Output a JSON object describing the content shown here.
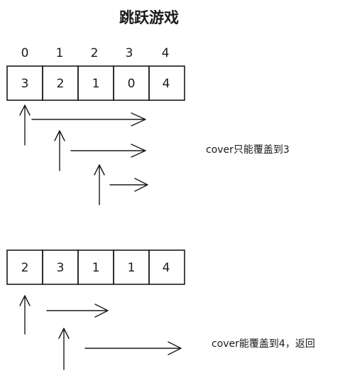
{
  "title": "跳跃游戏",
  "example1": {
    "indices": [
      "0",
      "1",
      "2",
      "3",
      "4"
    ],
    "values": [
      "3",
      "2",
      "1",
      "0",
      "4"
    ],
    "note": "cover只能覆盖到3"
  },
  "example2": {
    "values": [
      "2",
      "3",
      "1",
      "1",
      "4"
    ],
    "note": "cover能覆盖到4，返回"
  }
}
